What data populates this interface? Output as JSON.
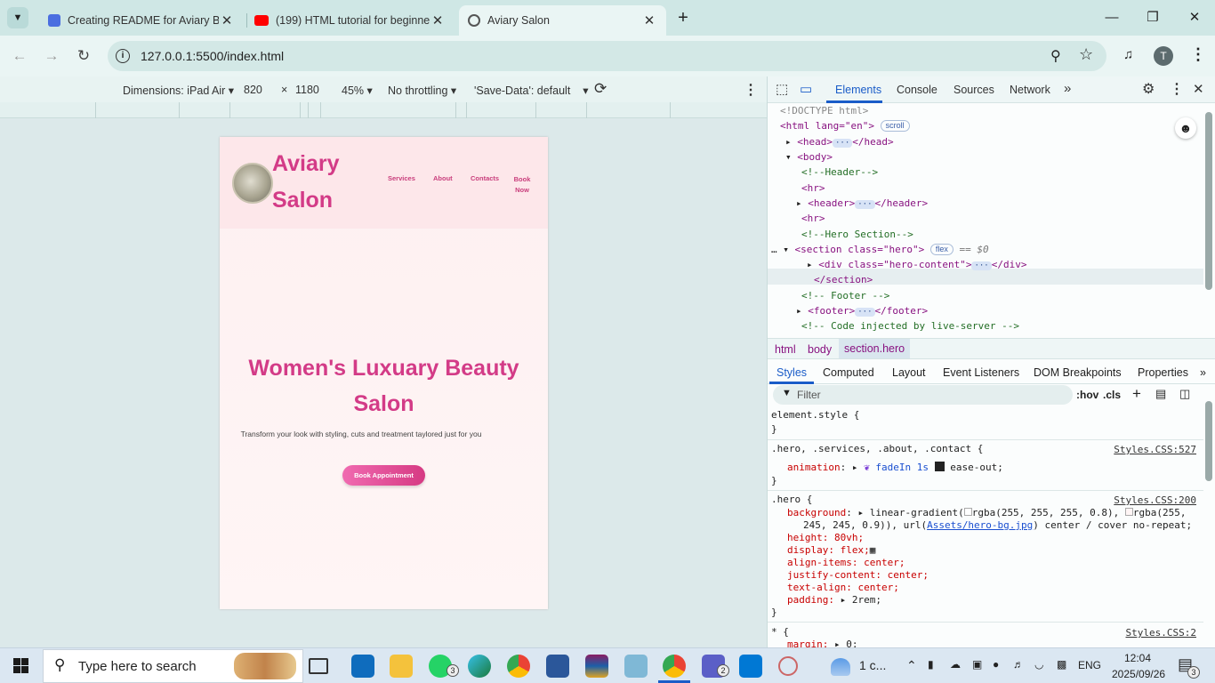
{
  "browser": {
    "tabs": [
      {
        "title": "Creating README for Aviary Be",
        "active": false
      },
      {
        "title": "(199) HTML tutorial for beginne",
        "active": false
      },
      {
        "title": "Aviary Salon",
        "active": true
      }
    ],
    "new_tab": "+",
    "url": "127.0.0.1:5500/index.html",
    "profile_initial": "T"
  },
  "emulation": {
    "device": "Dimensions: iPad Air",
    "width": "820",
    "times": "×",
    "height": "1180",
    "zoom": "45%",
    "throttle": "No throttling",
    "save_data": "'Save-Data': default"
  },
  "site": {
    "brand": "Aviary Salon",
    "nav": [
      "Services",
      "About",
      "Contacts",
      "Book Now"
    ],
    "hero_title": "Women's Luxuary Beauty Salon",
    "hero_text": "Transform your look with styling, cuts and treatment taylored just for you",
    "hero_button": "Book Appointment"
  },
  "devtools": {
    "tabs": [
      "Elements",
      "Console",
      "Sources",
      "Network"
    ],
    "dom": {
      "doctype": "<!DOCTYPE html>",
      "html_open": "<html lang=\"en\">",
      "scroll_badge": "scroll",
      "head": "<head>",
      "head_close": "</head>",
      "body": "<body>",
      "c_header": "<!--Header-->",
      "hr": "<hr>",
      "header": "<header>",
      "header_close": "</header>",
      "c_hero": "<!--Hero Section-->",
      "section_open": "<section class=\"hero\">",
      "flex_badge": "flex",
      "eq": "== $0",
      "div": "<div class=\"hero-content\">",
      "div_close": "</div>",
      "section_close": "</section>",
      "c_footer": "<!-- Footer -->",
      "footer": "<footer>",
      "footer_close": "</footer>",
      "c_live": "<!-- Code injected by live-server -->"
    },
    "breadcrumbs": [
      "html",
      "body",
      "section.hero"
    ],
    "subtabs": [
      "Styles",
      "Computed",
      "Layout",
      "Event Listeners",
      "DOM Breakpoints",
      "Properties"
    ],
    "filter_placeholder": "Filter",
    "hov": ":hov",
    "cls": ".cls",
    "styles": {
      "element_style": "element.style {",
      "close": "}",
      "rule1_selector": ".hero, .services, .about, .contact {",
      "rule1_src": "Styles.CSS:527",
      "rule1_prop": "animation",
      "rule1_val": "fadeIn 1s",
      "rule1_val2": "ease-out;",
      "rule2_selector": ".hero {",
      "rule2_src": "Styles.CSS:200",
      "bg_prop": "background",
      "bg_val1": "linear-gradient(",
      "bg_rgba1": "rgba(255, 255, 255, 0.8),",
      "bg_rgba2": "rgba(255,",
      "bg_cont": "245, 245, 0.9)), url(",
      "bg_url": "Assets/hero-bg.jpg",
      "bg_tail": ") center / cover no-repeat;",
      "height": "height: 80vh;",
      "display": "display: flex;",
      "align": "align-items: center;",
      "justify": "justify-content: center;",
      "textalign": "text-align: center;",
      "padding": "padding: ",
      "padding_val": "2rem;",
      "rule3_selector": "* {",
      "rule3_src": "Styles.CSS:2",
      "margin": "margin: ",
      "margin_val": "0;"
    }
  },
  "taskbar": {
    "search_placeholder": "Type here to search",
    "weather": "1 c...",
    "lang": "ENG",
    "time": "12:04",
    "date": "2025/09/26",
    "badge_whatsapp": "3",
    "badge_teams": "2",
    "notifications": "3"
  }
}
